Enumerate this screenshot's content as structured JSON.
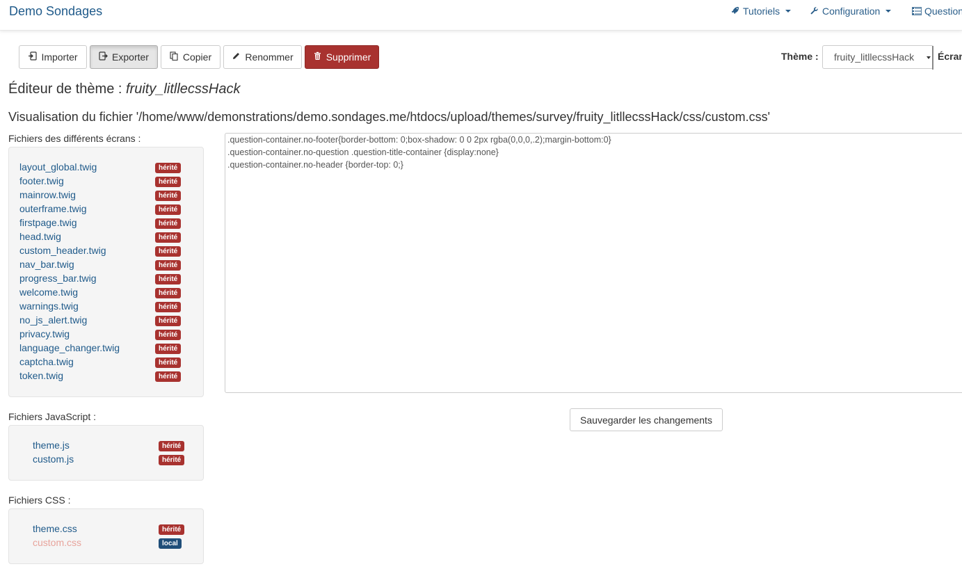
{
  "navbar": {
    "brand": "Demo Sondages",
    "items": [
      {
        "label": "Tutoriels",
        "icon": "rocket-icon"
      },
      {
        "label": "Configuration",
        "icon": "wrench-icon"
      },
      {
        "label": "Question",
        "icon": "list-icon"
      }
    ]
  },
  "toolbar": {
    "import_label": "Importer",
    "export_label": "Exporter",
    "copy_label": "Copier",
    "rename_label": "Renommer",
    "delete_label": "Supprimer",
    "theme_label": "Thème :",
    "theme_value": "fruity_litllecssHack",
    "screen_label": "Écran"
  },
  "editor_page": {
    "title_prefix": "Éditeur de thème :",
    "title_theme": "fruity_litllecssHack",
    "file_path": "Visualisation du fichier '/home/www/demonstrations/demo.sondages.me/htdocs/upload/themes/survey/fruity_litllecssHack/css/custom.css'"
  },
  "screen_files": {
    "label": "Fichiers des différents écrans :",
    "items": [
      {
        "name": "layout_global.twig",
        "badge": "hérité"
      },
      {
        "name": "footer.twig",
        "badge": "hérité"
      },
      {
        "name": "mainrow.twig",
        "badge": "hérité"
      },
      {
        "name": "outerframe.twig",
        "badge": "hérité"
      },
      {
        "name": "firstpage.twig",
        "badge": "hérité"
      },
      {
        "name": "head.twig",
        "badge": "hérité"
      },
      {
        "name": "custom_header.twig",
        "badge": "hérité"
      },
      {
        "name": "nav_bar.twig",
        "badge": "hérité"
      },
      {
        "name": "progress_bar.twig",
        "badge": "hérité"
      },
      {
        "name": "welcome.twig",
        "badge": "hérité"
      },
      {
        "name": "warnings.twig",
        "badge": "hérité"
      },
      {
        "name": "no_js_alert.twig",
        "badge": "hérité"
      },
      {
        "name": "privacy.twig",
        "badge": "hérité"
      },
      {
        "name": "language_changer.twig",
        "badge": "hérité"
      },
      {
        "name": "captcha.twig",
        "badge": "hérité"
      },
      {
        "name": "token.twig",
        "badge": "hérité"
      }
    ]
  },
  "js_files": {
    "label": "Fichiers JavaScript :",
    "items": [
      {
        "name": "theme.js",
        "badge": "hérité"
      },
      {
        "name": "custom.js",
        "badge": "hérité"
      }
    ]
  },
  "css_files": {
    "label": "Fichiers CSS :",
    "items": [
      {
        "name": "theme.css",
        "badge": "hérité"
      },
      {
        "name": "custom.css",
        "badge": "local"
      }
    ]
  },
  "code": {
    "lines": [
      ".question-container.no-footer{border-bottom: 0;box-shadow: 0 0 2px rgba(0,0,0,.2);margin-bottom:0}",
      ".question-container.no-question .question-title-container {display:none}",
      ".question-container.no-header {border-top: 0;}"
    ]
  },
  "save_label": "Sauvegarder les changements",
  "colors": {
    "link": "#1f5a8a",
    "danger": "#a8322f",
    "badge_local": "#1f4e79",
    "current_file": "#e8a49c"
  }
}
